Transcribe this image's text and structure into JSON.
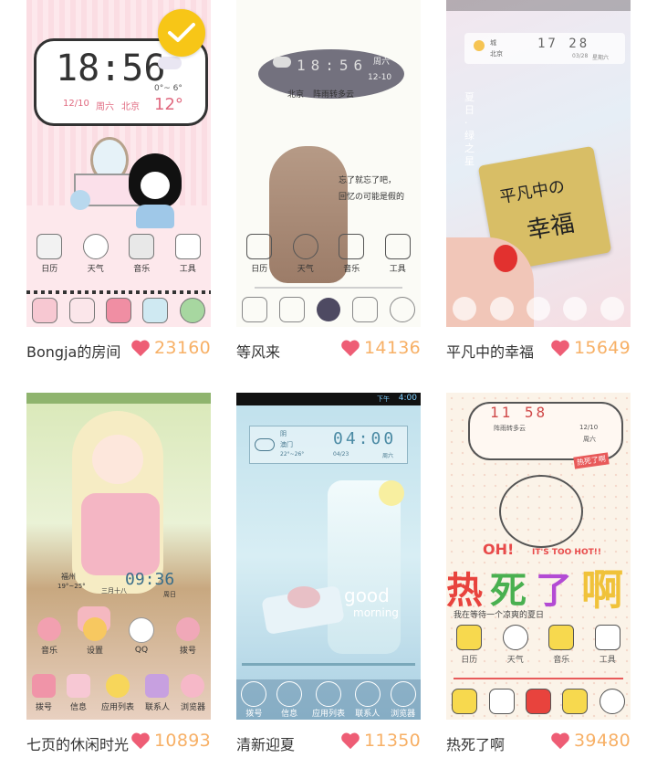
{
  "themes": [
    {
      "title": "Bongja的房间",
      "likes": "23160",
      "selected": true,
      "clock": {
        "time": "18:56",
        "date": "12/10",
        "weekday": "周六",
        "city": "北京",
        "range": "0°~ 6°",
        "temp": "12°"
      },
      "apps": [
        "日历",
        "天气",
        "音乐",
        "工具"
      ]
    },
    {
      "title": "等风来",
      "likes": "14136",
      "clock": {
        "time": "18:56",
        "weekday": "周六",
        "date": "12-10",
        "city": "北京",
        "weather": "阵雨转多云"
      },
      "caption_line1": "忘了就忘了吧，",
      "caption_line2": "回忆の可能是假的",
      "apps": [
        "日历",
        "天气",
        "音乐",
        "工具"
      ]
    },
    {
      "title": "平凡中的幸福",
      "likes": "15649",
      "clock": {
        "time": "17 28",
        "date": "03/28",
        "weekday": "星期六"
      },
      "widget_city": "城",
      "widget_sub": "北京",
      "side_text": "夏日·绿之星",
      "sign_line1": "平凡中の",
      "sign_line2": "幸福"
    },
    {
      "title": "七页的休闲时光",
      "likes": "10893",
      "clock": {
        "time": "09:36",
        "city": "福州",
        "range": "19°~25°",
        "weekday": "三月十八",
        "day": "周日"
      },
      "apps_row1": [
        "音乐",
        "设置",
        "QQ",
        "拨号"
      ],
      "apps_row2": [
        "拨号",
        "信息",
        "应用列表",
        "联系人",
        "浏览器"
      ]
    },
    {
      "title": "清新迎夏",
      "likes": "11350",
      "status_time": "4:00",
      "status_label": "下午",
      "clock": {
        "time": "04:00",
        "weather": "阴",
        "city": "澳门",
        "range": "22°~26°",
        "date": "04/23",
        "weekday": "周六"
      },
      "cup_text1": "good",
      "cup_text2": "morning",
      "dock": [
        "拨号",
        "信息",
        "应用列表",
        "联系人",
        "浏览器"
      ]
    },
    {
      "title": "热死了啊",
      "likes": "39480",
      "clock": {
        "time": "11 58",
        "weather": "阵雨转多云",
        "date": "12/10",
        "weekday": "周六"
      },
      "banner_oh": "OH!",
      "banner_en": "IT'S TOO HOT!!",
      "big_text": [
        "热",
        "死",
        "了",
        "啊"
      ],
      "subline": "我在等待一个凉爽的夏日",
      "tag": "热死了啊",
      "apps": [
        "日历",
        "天气",
        "音乐",
        "工具"
      ]
    }
  ],
  "colors": {
    "heart": "#ee5d75",
    "count": "#f7b066",
    "check": "#f7c617"
  }
}
